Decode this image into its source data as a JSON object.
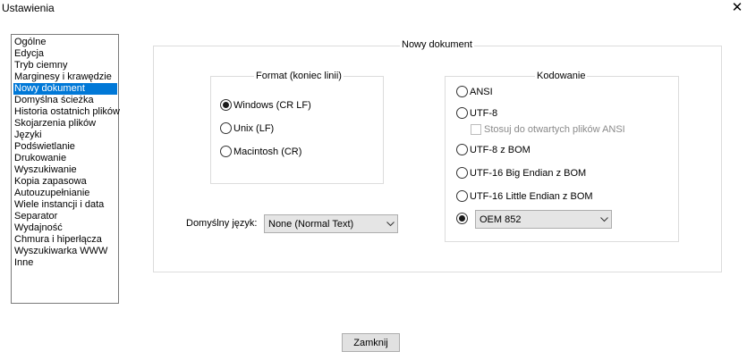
{
  "window": {
    "title": "Ustawienia",
    "close_glyph": "✕"
  },
  "sidebar": {
    "selected_index": 4,
    "items": [
      "Ogólne",
      "Edycja",
      "Tryb ciemny",
      "Marginesy i krawędzie",
      "Nowy dokument",
      "Domyślna ścieżka",
      "Historia ostatnich plików",
      "Skojarzenia plików",
      "Języki",
      "Podświetlanie",
      "Drukowanie",
      "Wyszukiwanie",
      "Kopia zapasowa",
      "Autouzupełnianie",
      "Wiele instancji i data",
      "Separator",
      "Wydajność",
      "Chmura i hiperłącza",
      "Wyszukiwarka WWW",
      "Inne"
    ]
  },
  "new_document": {
    "group_title": "Nowy dokument",
    "format": {
      "title": "Format (koniec linii)",
      "options": [
        {
          "label": "Windows (CR LF)",
          "checked": true
        },
        {
          "label": "Unix (LF)",
          "checked": false
        },
        {
          "label": "Macintosh (CR)",
          "checked": false
        }
      ]
    },
    "default_language": {
      "label": "Domyślny język:",
      "value": "None (Normal Text)"
    },
    "encoding": {
      "title": "Kodowanie",
      "ansi": "ANSI",
      "utf8": "UTF-8",
      "apply_ansi_checkbox": "Stosuj do otwartych plików ANSI",
      "utf8_bom": "UTF-8 z BOM",
      "utf16_be": "UTF-16 Big Endian z BOM",
      "utf16_le": "UTF-16 Little Endian z BOM",
      "other_value": "OEM 852",
      "selected": "other"
    }
  },
  "footer": {
    "close_button": "Zamknij"
  }
}
